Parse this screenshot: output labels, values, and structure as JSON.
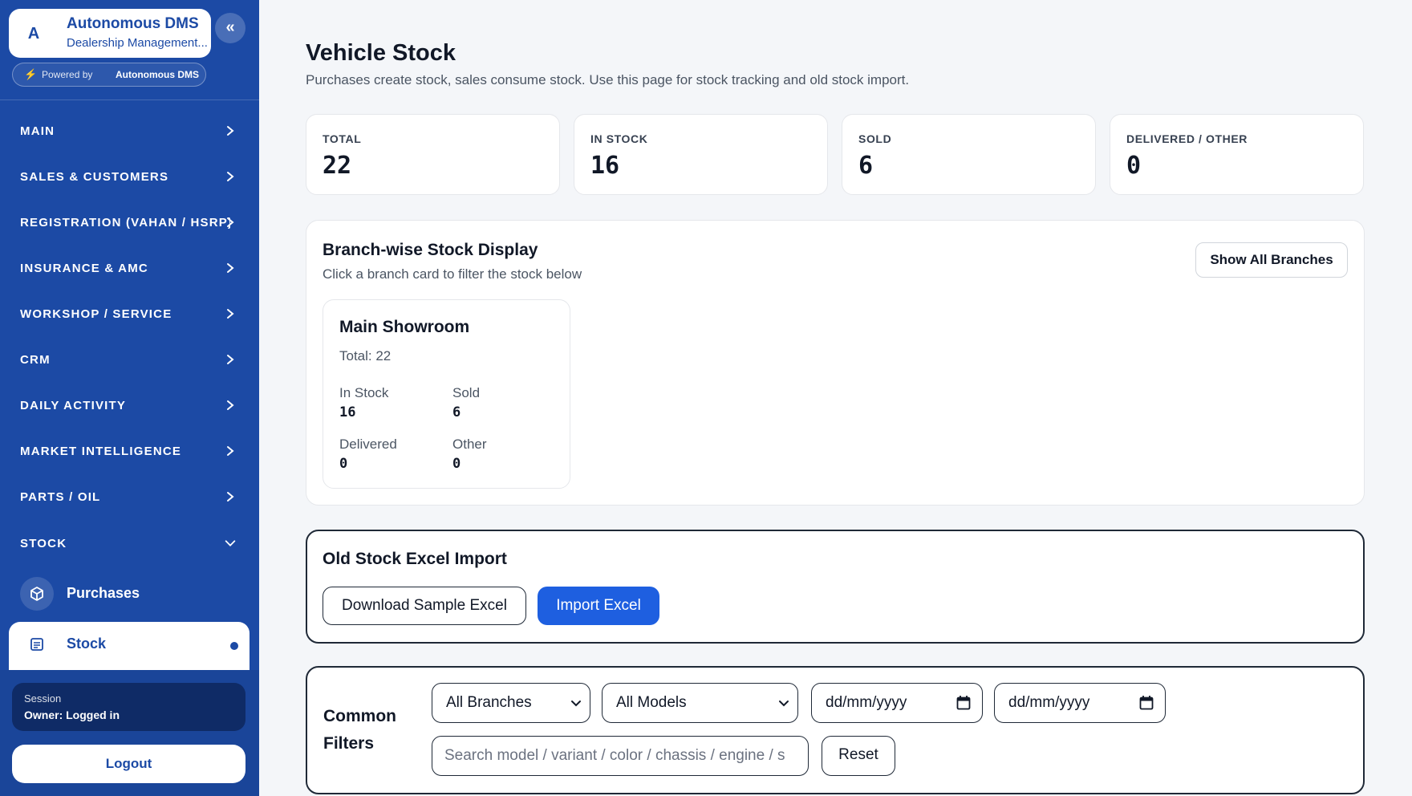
{
  "brand": {
    "avatar_letter": "A",
    "title": "Autonomous DMS",
    "subtitle": "Dealership Management...",
    "collapse_icon": "«",
    "powered_label": "Powered by",
    "powered_name": "Autonomous DMS"
  },
  "nav": {
    "items": [
      {
        "label": "MAIN"
      },
      {
        "label": "SALES & CUSTOMERS"
      },
      {
        "label": "REGISTRATION (VAHAN / HSRP)"
      },
      {
        "label": "INSURANCE & AMC"
      },
      {
        "label": "WORKSHOP / SERVICE"
      },
      {
        "label": "CRM"
      },
      {
        "label": "DAILY ACTIVITY"
      },
      {
        "label": "MARKET INTELLIGENCE"
      },
      {
        "label": "PARTS / OIL"
      },
      {
        "label": "STOCK"
      }
    ],
    "stock_sub": [
      {
        "label": "Purchases",
        "icon": "cube-icon"
      },
      {
        "label": "Stock",
        "icon": "list-icon"
      }
    ]
  },
  "session": {
    "label": "Session",
    "value": "Owner: Logged in",
    "logout_label": "Logout"
  },
  "page": {
    "title": "Vehicle Stock",
    "subtitle": "Purchases create stock, sales consume stock. Use this page for stock tracking and old stock import."
  },
  "stats": [
    {
      "label": "TOTAL",
      "value": "22"
    },
    {
      "label": "IN STOCK",
      "value": "16"
    },
    {
      "label": "SOLD",
      "value": "6"
    },
    {
      "label": "DELIVERED / OTHER",
      "value": "0"
    }
  ],
  "branch": {
    "title": "Branch-wise Stock Display",
    "subtitle": "Click a branch card to filter the stock below",
    "show_all_label": "Show All Branches",
    "card": {
      "name": "Main Showroom",
      "total": "Total: 22",
      "in_stock_label": "In Stock",
      "in_stock_value": "16",
      "sold_label": "Sold",
      "sold_value": "6",
      "delivered_label": "Delivered",
      "delivered_value": "0",
      "other_label": "Other",
      "other_value": "0"
    }
  },
  "import": {
    "title": "Old Stock Excel Import",
    "download_label": "Download Sample Excel",
    "import_label": "Import Excel"
  },
  "filters": {
    "title": "Common Filters",
    "branch_value": "All Branches",
    "model_value": "All Models",
    "date_from": "dd/mm/yyyy",
    "date_to": "dd/mm/yyyy",
    "search_placeholder": "Search model / variant / color / chassis / engine / s",
    "reset_label": "Reset"
  },
  "colors": {
    "sidebar": "#1c4aa5",
    "primary": "#1e5fe0"
  }
}
